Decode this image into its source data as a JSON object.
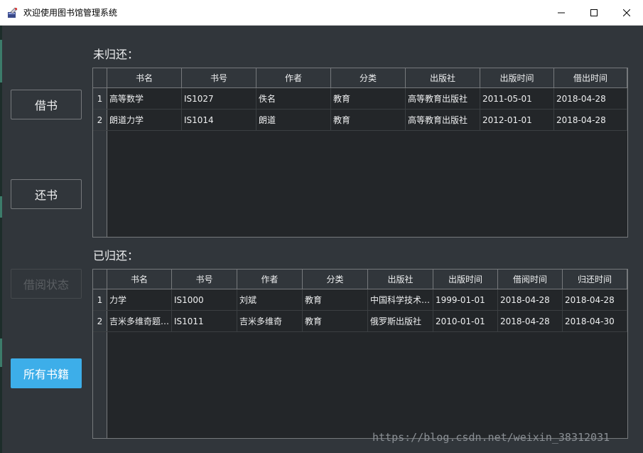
{
  "window": {
    "title": "欢迎使用图书馆管理系统",
    "minimize": "—",
    "maximize": "☐",
    "close": "✕"
  },
  "sidebar": {
    "borrow": "借书",
    "return": "还书",
    "status": "借阅状态",
    "all_books": "所有书籍"
  },
  "unreturned": {
    "label": "未归还：",
    "columns": [
      "书名",
      "书号",
      "作者",
      "分类",
      "出版社",
      "出版时间",
      "借出时间"
    ],
    "rows": [
      {
        "num": "1",
        "cells": [
          "高等数学",
          "IS1027",
          "佚名",
          "教育",
          "高等教育出版社",
          "2011-05-01",
          "2018-04-28"
        ]
      },
      {
        "num": "2",
        "cells": [
          "朗道力学",
          "IS1014",
          "朗道",
          "教育",
          "高等教育出版社",
          "2012-01-01",
          "2018-04-28"
        ]
      }
    ]
  },
  "returned": {
    "label": "已归还：",
    "columns": [
      "书名",
      "书号",
      "作者",
      "分类",
      "出版社",
      "出版时间",
      "借阅时间",
      "归还时间"
    ],
    "rows": [
      {
        "num": "1",
        "cells": [
          "力学",
          "IS1000",
          "刘斌",
          "教育",
          "中国科学技术…",
          "1999-01-01",
          "2018-04-28",
          "2018-04-28"
        ]
      },
      {
        "num": "2",
        "cells": [
          "吉米多维奇题…",
          "IS1011",
          "吉米多维奇",
          "教育",
          "俄罗斯出版社",
          "2010-01-01",
          "2018-04-28",
          "2018-04-30"
        ]
      }
    ]
  },
  "watermark": "https://blog.csdn.net/weixin_38312031",
  "colors": {
    "background": "#31363b",
    "table_bg": "#232629",
    "accent": "#3daee9",
    "text": "#eff0f1"
  }
}
